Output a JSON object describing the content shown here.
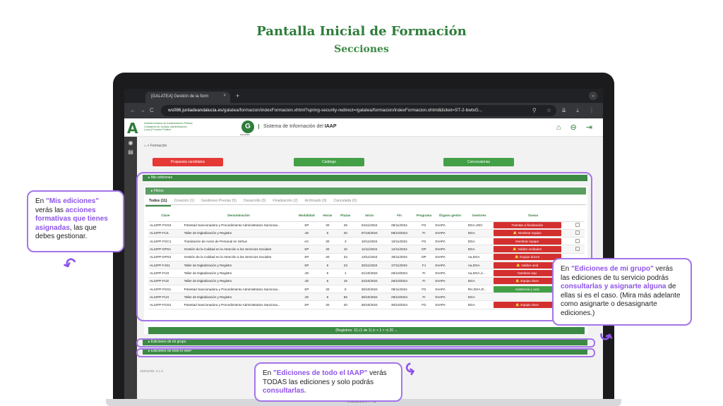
{
  "slide": {
    "title": "Pantalla Inicial de Formación",
    "subtitle": "Secciones",
    "laptop_label": "MacBook Pro"
  },
  "browser": {
    "tab_title": "[GALATEA] Gestión de la form",
    "tab_close": "×",
    "new_tab": "+",
    "menu_chevron": "⌄",
    "nav_back": "←",
    "nav_forward": "→",
    "nav_reload": "C",
    "url_host": "ws086.juntadeandalucia.es",
    "url_path": "/galatea/formacion/indexFormacion.xhtml?spring-security-redirect=/galatea/formacion/indexFormacion.xhtml&ticket=ST-2-bwtxG...",
    "url_icons": "⚲ ☆ ⇊ ⤓ ⋮"
  },
  "app": {
    "logo_letter": "A",
    "institute": "Instituto Andaluz de Administración Pública Consejería de Justicia, Administración Local y Función Pública",
    "galatea_letter": "G",
    "galatea_label": "GALATEA",
    "system_prefix": "Sistema de Información del ",
    "system_bold": "IAAP",
    "header_icons": "⌂ ⊖ ⇥",
    "sidebar_icons": [
      "◉",
      "▤"
    ],
    "breadcrumb": "⌂ > Formación",
    "buttons": {
      "proposals": "Propuesta candidatos",
      "catalog": "Catálogo",
      "calls": "Convocatorias"
    },
    "colors": {
      "red": "#e53935",
      "green": "#43a047",
      "dark_green": "#3c8a45",
      "purple": "#a475e8"
    },
    "section_mine": "Mis ediciones",
    "section_group": "Ediciones de mi grupo",
    "section_all": "Ediciones de todo el IAAP",
    "filters": "Filtros",
    "tabs": [
      "Todos (11)",
      "Creación (1)",
      "Gestiones Previas (5)",
      "Desarrollo (3)",
      "Finalización (2)",
      "Archivado (0)",
      "Cancelada (0)"
    ],
    "columns": [
      "Clave",
      "Denominación",
      "Modalidad",
      "Horas",
      "Plazas",
      "Inicio",
      "Fin",
      "Programa",
      "Órgano gestor",
      "Gestores",
      "Tareas"
    ],
    "rows": [
      [
        "AL24PF-FGS3",
        "Potestad Sancionadora y Procedimiento Administrativo Sanciona...",
        "SP",
        "20",
        "25",
        "04/11/2024",
        "06/11/2024",
        "FG",
        "SVAPA",
        "DGA,VNC",
        "Tramitar a finalización",
        "red"
      ],
      [
        "AL24PF-FIJ1",
        "Taller de Digitalización y Registro",
        "JO",
        "6",
        "20",
        "07/10/2024",
        "08/10/2024",
        "FI",
        "SVAPA",
        "DGA",
        "🔔 Nombrar equipo",
        "red"
      ],
      [
        "AL24PF-FGC1",
        "Tramitación de Actos de Personal en Sirhus",
        "AC",
        "20",
        "3",
        "10/11/2024",
        "10/11/2024",
        "FG",
        "SVAPA",
        "DGA",
        "Nombrar equipo",
        "red"
      ],
      [
        "AL24PF-DPS1",
        "Gestión de la Calidad en la Atención a los Servicios Sociales",
        "SP",
        "20",
        "10",
        "11/11/2024",
        "12/11/2024",
        "DP",
        "SVAPA",
        "DGA",
        "🔔 Validar unidades",
        "red"
      ],
      [
        "AL24PF-DPS2",
        "Gestión de la Calidad en la Atención a los Servicios Sociales",
        "SP",
        "20",
        "34",
        "13/11/2024",
        "30/11/2024",
        "DP",
        "SVAPA",
        "Aa,DGA",
        "🔔 Equipo docen",
        "red"
      ],
      [
        "AL24PF-FJS1",
        "Taller de Digitalización y Registro",
        "SP",
        "6",
        "23",
        "20/11/2024",
        "27/11/2024",
        "FJ",
        "SVAPA",
        "Aa,DGA",
        "🔔 Validar unid",
        "red"
      ],
      [
        "AL24PF-FIJ3",
        "Taller de Digitalización y Registro",
        "JO",
        "6",
        "1",
        "21/10/2024",
        "25/10/2024",
        "FI",
        "SVAPA",
        "Aa,DGA,Á...",
        "Nombrar equ",
        "red"
      ],
      [
        "AL24PF-FIJ2",
        "Taller de Digitalización y Registro",
        "JO",
        "6",
        "15",
        "24/10/2024",
        "25/10/2024",
        "FI",
        "SVAPA",
        "DGA",
        "🔔 Equipo doce",
        "red"
      ],
      [
        "AL24PF-FGS1",
        "Potestad Sancionadora y Procedimiento Administrativo Sanciona...",
        "SP",
        "20",
        "5",
        "28/10/2024",
        "08/11/2024",
        "FG",
        "SVAPA",
        "RH,DGA,R...",
        "Asistencia y acta",
        "green"
      ],
      [
        "AL24PF-FIJ4",
        "Taller de Digitalización y Registro",
        "JO",
        "6",
        "56",
        "28/10/2024",
        "29/10/2024",
        "FI",
        "SVAPA",
        "DGA",
        "",
        ""
      ],
      [
        "AL24PF-FGS2",
        "Potestad Sancionadora y Procedimiento Administrativo Sanciona...",
        "SP",
        "20",
        "20",
        "28/10/2024",
        "30/10/2024",
        "FG",
        "SVAPA",
        "DGA",
        "🔔 Equipo doce",
        "red"
      ]
    ],
    "pager": "(Registros: 11)   (1 de 1)   |<  <   1   >  >|   20 ⌄",
    "version": "VERSIÓN: 2.1.0"
  },
  "callouts": {
    "mine": {
      "pre": "En ",
      "b1": "\"Mis ediciones\"",
      "mid1": " verás las ",
      "b2": "acciones formativas que tienes asignadas",
      "post": ", las que debes gestionar."
    },
    "group": {
      "pre": "En ",
      "b1": "\"Ediciones de mi grupo\"",
      "mid1": " verás las ediciones de tu servicio podrás ",
      "b2": "consultarlas y asignarte alguna",
      "post": " de ellas si es el caso. (Mira más adelante como asignarte o desasignarte ediciones.)"
    },
    "all": {
      "pre": "En ",
      "b1": "\"Ediciones de  todo el IAAP\"",
      "mid1": " verás TODAS las ediciones y solo podrás ",
      "b2": "consultarlas."
    }
  }
}
